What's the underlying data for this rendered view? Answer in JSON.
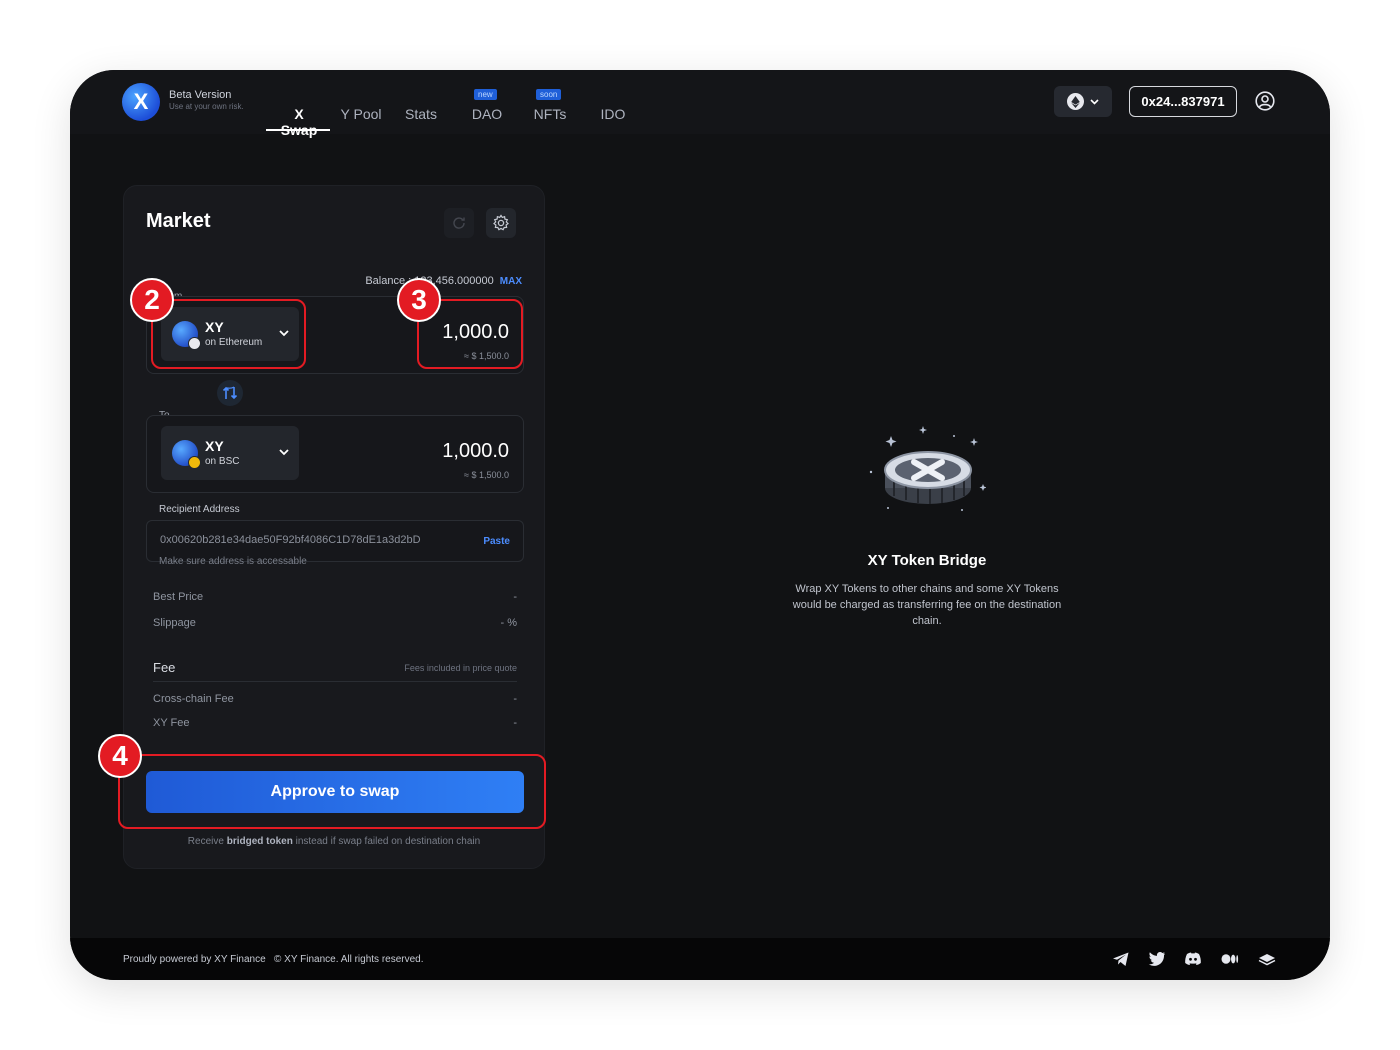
{
  "header": {
    "beta_title": "Beta Version",
    "beta_subtitle": "Use at your own risk.",
    "logo_letter": "X",
    "nav": [
      {
        "label": "X Swap",
        "active": true
      },
      {
        "label": "Y Pool"
      },
      {
        "label": "Stats"
      },
      {
        "label": "DAO",
        "badge": "new"
      },
      {
        "label": "NFTs",
        "badge": "soon"
      },
      {
        "label": "IDO"
      }
    ],
    "chain_icon": "ethereum-icon",
    "wallet_address": "0x24...837971"
  },
  "card": {
    "title": "Market",
    "balance_text": "Balance : 123,456.000000",
    "max_label": "MAX",
    "from": {
      "label": "From",
      "token": "XY",
      "chain": "on Ethereum",
      "amount": "1,000.0",
      "usd": "≈ $ 1,500.0"
    },
    "to": {
      "label": "To",
      "token": "XY",
      "chain": "on BSC",
      "amount": "1,000.0",
      "usd": "≈ $ 1,500.0"
    },
    "recipient_label": "Recipient Address",
    "recipient_address": "0x00620b281e34dae50F92bf4086C1D78dE1a3d2bD",
    "paste_label": "Paste",
    "recipient_hint": "Make sure address is accessable",
    "best_price_label": "Best Price",
    "best_price_value": "-",
    "slippage_label": "Slippage",
    "slippage_value": "- %",
    "fee_title": "Fee",
    "fee_note": "Fees included in price quote",
    "cross_chain_fee_label": "Cross-chain Fee",
    "cross_chain_fee_value": "-",
    "xy_fee_label": "XY Fee",
    "xy_fee_value": "-",
    "approve_label": "Approve to swap",
    "receive_note_pre": "Receive",
    "receive_note_bold": "bridged token",
    "receive_note_post": "instead if swap failed on destination chain"
  },
  "annotations": [
    "2",
    "3",
    "4"
  ],
  "bridge": {
    "title": "XY Token Bridge",
    "description": "Wrap XY Tokens to other chains and some XY Tokens would be charged as transferring fee on the destination chain."
  },
  "footer": {
    "powered": "Proudly powered by XY Finance",
    "copyright": "© XY Finance. All rights reserved.",
    "social_icons": [
      "telegram-icon",
      "twitter-icon",
      "discord-icon",
      "medium-icon",
      "gitbook-icon"
    ]
  },
  "colors": {
    "accent": "#2f7ff5",
    "annotation": "#e31b23",
    "background": "#111214"
  }
}
